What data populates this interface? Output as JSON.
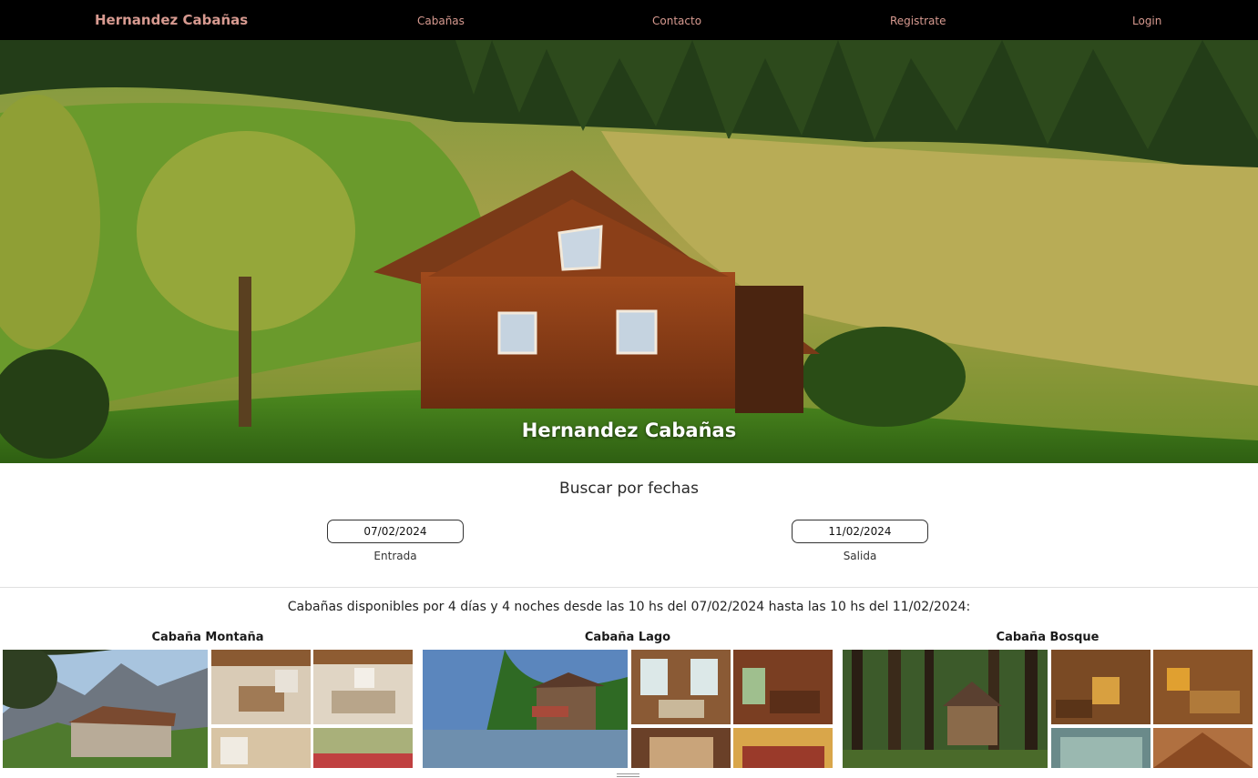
{
  "navbar": {
    "brand": "Hernandez Cabañas",
    "links": [
      "Cabañas",
      "Contacto",
      "Registrate",
      "Login"
    ]
  },
  "hero": {
    "title": "Hernandez Cabañas"
  },
  "search": {
    "title": "Buscar por fechas",
    "entrada_value": "07/02/2024",
    "entrada_label": "Entrada",
    "salida_value": "11/02/2024",
    "salida_label": "Salida"
  },
  "availability_text": "Cabañas disponibles por 4 días y 4 noches desde las 10 hs del 07/02/2024 hasta las 10 hs del 11/02/2024:",
  "cabins": [
    {
      "name": "Cabaña Montaña"
    },
    {
      "name": "Cabaña Lago"
    },
    {
      "name": "Cabaña Bosque"
    }
  ],
  "colors": {
    "nav_bg": "#000000",
    "nav_text": "#d79a90",
    "hero_title": "#ffffff"
  }
}
